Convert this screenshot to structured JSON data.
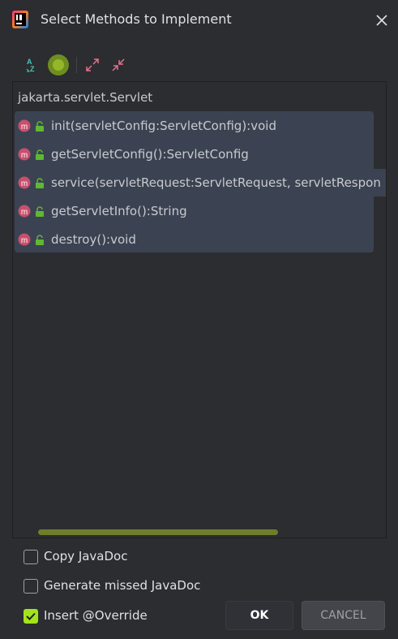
{
  "window": {
    "title": "Select Methods to Implement",
    "app_icon": "intellij-idea-icon",
    "close_icon": "close-icon"
  },
  "toolbar": {
    "buttons": [
      {
        "name": "sort-alphabetically",
        "icon": "sort-az-icon"
      },
      {
        "name": "show-classes",
        "icon": "class-circle-icon"
      },
      {
        "name": "expand-all",
        "icon": "expand-icon"
      },
      {
        "name": "collapse-all",
        "icon": "collapse-icon"
      }
    ]
  },
  "tree": {
    "root_label": "jakarta.servlet.Servlet",
    "methods": [
      {
        "label": "init(servletConfig:ServletConfig):void",
        "icon": "method-icon",
        "access_icon": "public-lock-icon"
      },
      {
        "label": "getServletConfig():ServletConfig",
        "icon": "method-icon",
        "access_icon": "public-lock-icon"
      },
      {
        "label": "service(servletRequest:ServletRequest, servletRespon",
        "icon": "method-icon",
        "access_icon": "public-lock-icon"
      },
      {
        "label": "getServletInfo():String",
        "icon": "method-icon",
        "access_icon": "public-lock-icon"
      },
      {
        "label": "destroy():void",
        "icon": "method-icon",
        "access_icon": "public-lock-icon"
      }
    ]
  },
  "options": {
    "copy_javadoc": {
      "label": "Copy JavaDoc",
      "checked": false
    },
    "generate_javadoc": {
      "label": "Generate missed JavaDoc",
      "checked": false
    },
    "insert_override": {
      "label": "Insert @Override",
      "checked": true
    }
  },
  "buttons": {
    "ok": "OK",
    "cancel": "CANCEL"
  },
  "colors": {
    "accent": "#a3e31c",
    "selection": "#3b4352",
    "method_icon": "#c94f6d"
  }
}
